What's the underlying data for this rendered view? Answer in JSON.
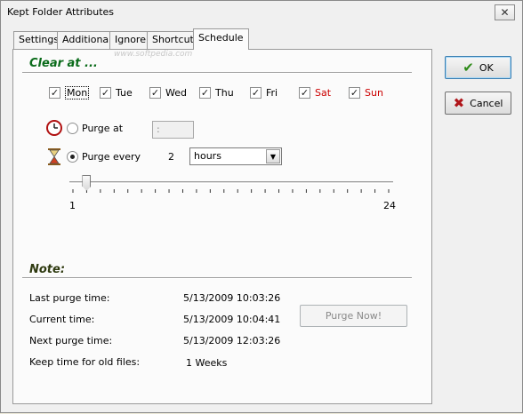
{
  "window": {
    "title": "Kept Folder Attributes",
    "close_glyph": "✕"
  },
  "tabs": [
    {
      "label": "Settings"
    },
    {
      "label": "Additional"
    },
    {
      "label": "Ignore"
    },
    {
      "label": "Shortcut"
    },
    {
      "label": "Schedule",
      "active": true
    }
  ],
  "watermark": "www.softpedia.com",
  "clear_section": {
    "title": "Clear at ...",
    "days": [
      {
        "label": "Mon",
        "checked": true
      },
      {
        "label": "Tue",
        "checked": true
      },
      {
        "label": "Wed",
        "checked": true
      },
      {
        "label": "Thu",
        "checked": true
      },
      {
        "label": "Fri",
        "checked": true
      },
      {
        "label": "Sat",
        "checked": true,
        "color": "#cc0000"
      },
      {
        "label": "Sun",
        "checked": true,
        "color": "#cc0000"
      }
    ],
    "purge_at": {
      "label": "Purge at",
      "selected": false,
      "time_value": ":"
    },
    "purge_every": {
      "label": "Purge every",
      "selected": true,
      "value": "2",
      "unit": "hours"
    },
    "slider": {
      "min": "1",
      "max": "24",
      "value": 2
    }
  },
  "note_section": {
    "title": "Note:",
    "rows": [
      {
        "label": "Last purge time:",
        "value": "5/13/2009 10:03:26"
      },
      {
        "label": "Current time:",
        "value": "5/13/2009 10:04:41"
      },
      {
        "label": "Next purge time:",
        "value": "5/13/2009 12:03:26"
      },
      {
        "label": "Keep time for old files:",
        "value": "1 Weeks"
      }
    ],
    "purge_now_label": "Purge Now!"
  },
  "buttons": {
    "ok_label": "OK",
    "cancel_label": "Cancel",
    "ok_glyph": "✔",
    "cancel_glyph": "✖"
  },
  "colors": {
    "clear_title": "#0a6b1a",
    "note_title": "#2f3a10",
    "weekend": "#cc0000"
  }
}
